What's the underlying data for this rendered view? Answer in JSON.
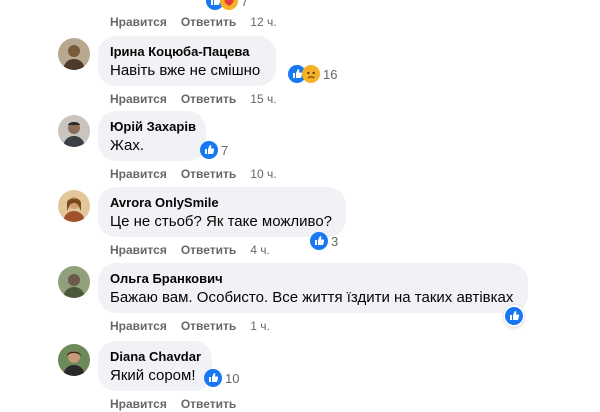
{
  "colors": {
    "bubble_bg": "#f0f2f5",
    "secondary_text": "#65676b",
    "like_blue": "#1877f2",
    "reaction_yellow": "#f7b125"
  },
  "comments": [
    {
      "author": "",
      "text": "",
      "like_label": "Нравится",
      "reply_label": "Ответить",
      "time": "12 ч.",
      "reactions": [
        "like-icon",
        "care-icon"
      ],
      "reaction_count": "7"
    },
    {
      "author": "Ірина Коцюба-Пацева",
      "text": "Навіть вже не смішно",
      "like_label": "Нравится",
      "reply_label": "Ответить",
      "time": "15 ч.",
      "reactions": [
        "like-icon",
        "sad-icon"
      ],
      "reaction_count": "16"
    },
    {
      "author": "Юрій Захарів",
      "text": "Жах.",
      "like_label": "Нравится",
      "reply_label": "Ответить",
      "time": "10 ч.",
      "reactions": [
        "like-icon"
      ],
      "reaction_count": "7"
    },
    {
      "author": "Avrora OnlySmile",
      "text": "Це не стьоб? Як таке можливо?",
      "like_label": "Нравится",
      "reply_label": "Ответить",
      "time": "4 ч.",
      "reactions": [
        "like-icon"
      ],
      "reaction_count": "3"
    },
    {
      "author": "Ольга Бранкович",
      "text": "Бажаю вам. Особисто. Все життя їздити на таких автівках",
      "like_label": "Нравится",
      "reply_label": "Ответить",
      "time": "1 ч.",
      "reactions": [
        "like-icon"
      ],
      "reaction_count": ""
    },
    {
      "author": "Diana Chavdar",
      "text": "Який сором!",
      "like_label": "Нравится",
      "reply_label": "Ответить",
      "time": "",
      "reactions": [
        "like-icon"
      ],
      "reaction_count": "10"
    }
  ]
}
